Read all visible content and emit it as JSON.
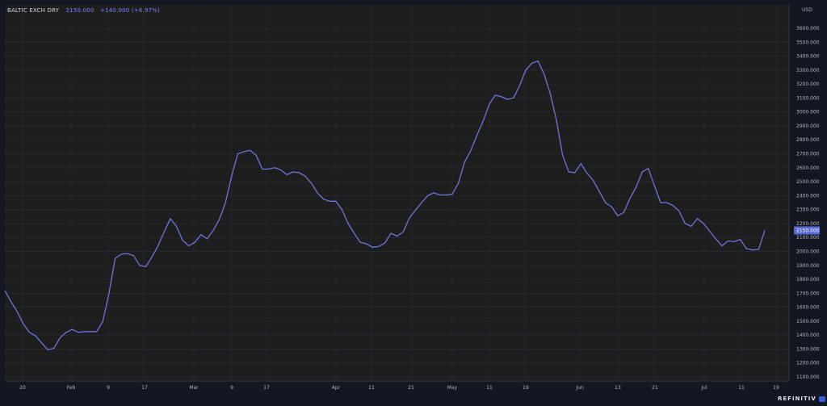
{
  "header": {
    "instrument": "BALTIC EXCH DRY",
    "last": "2150.000",
    "change": "+140.000 (+6.97%)"
  },
  "axis": {
    "currency": "USD"
  },
  "brand": {
    "name": "REFINITIV",
    "icon": "refinitiv-logo-icon"
  },
  "colors": {
    "line": "#6e75d9",
    "background": "#1e1e1e",
    "grid": "#2a2e39",
    "price_tag": "#5b6bd6"
  },
  "chart_data": {
    "type": "line",
    "series": [
      {
        "values": [
          1720,
          1640,
          1570,
          1480,
          1420,
          1395,
          1345,
          1295,
          1305,
          1380,
          1420,
          1440,
          1420,
          1425,
          1425,
          1425,
          1500,
          1700,
          1950,
          1980,
          1985,
          1970,
          1900,
          1890,
          1960,
          2040,
          2140,
          2235,
          2180,
          2080,
          2040,
          2065,
          2120,
          2090,
          2150,
          2230,
          2350,
          2540,
          2700,
          2715,
          2725,
          2690,
          2590,
          2590,
          2600,
          2585,
          2550,
          2570,
          2565,
          2540,
          2490,
          2420,
          2375,
          2360,
          2360,
          2300,
          2200,
          2130,
          2065,
          2055,
          2030,
          2035,
          2060,
          2130,
          2110,
          2140,
          2240,
          2295,
          2350,
          2400,
          2420,
          2405,
          2405,
          2410,
          2490,
          2640,
          2720,
          2830,
          2930,
          3050,
          3120,
          3110,
          3090,
          3100,
          3190,
          3300,
          3350,
          3365,
          3270,
          3130,
          2940,
          2690,
          2570,
          2565,
          2630,
          2560,
          2510,
          2430,
          2350,
          2320,
          2255,
          2280,
          2380,
          2460,
          2570,
          2595,
          2470,
          2350,
          2350,
          2330,
          2290,
          2200,
          2180,
          2235,
          2200,
          2145,
          2090,
          2040,
          2075,
          2070,
          2085,
          2020,
          2010,
          2015,
          2150
        ]
      }
    ],
    "x_tick_labels": [
      "20",
      "Feb",
      "9",
      "17",
      "Mar",
      "9",
      "17",
      "Apr",
      "11",
      "21",
      "May",
      "11",
      "19",
      "Jun",
      "13",
      "21",
      "Jul",
      "11",
      "19"
    ],
    "y_tick_labels": [
      "1100.000",
      "1200.000",
      "1300.000",
      "1400.000",
      "1500.000",
      "1600.000",
      "1700.000",
      "1800.000",
      "1900.000",
      "2000.000",
      "2100.000",
      "2200.000",
      "2300.000",
      "2400.000",
      "2500.000",
      "2600.000",
      "2700.000",
      "2800.000",
      "2900.000",
      "3000.000",
      "3100.000",
      "3200.000",
      "3300.000",
      "3400.000",
      "3500.000",
      "3600.000"
    ],
    "y_ticks": [
      1100,
      1200,
      1300,
      1400,
      1500,
      1600,
      1700,
      1800,
      1900,
      2000,
      2100,
      2200,
      2300,
      2400,
      2500,
      2600,
      2700,
      2800,
      2900,
      3000,
      3100,
      3200,
      3300,
      3400,
      3500,
      3600
    ],
    "ylim": [
      1050,
      3800
    ],
    "last_value_label": "2150.000",
    "grid": true
  }
}
